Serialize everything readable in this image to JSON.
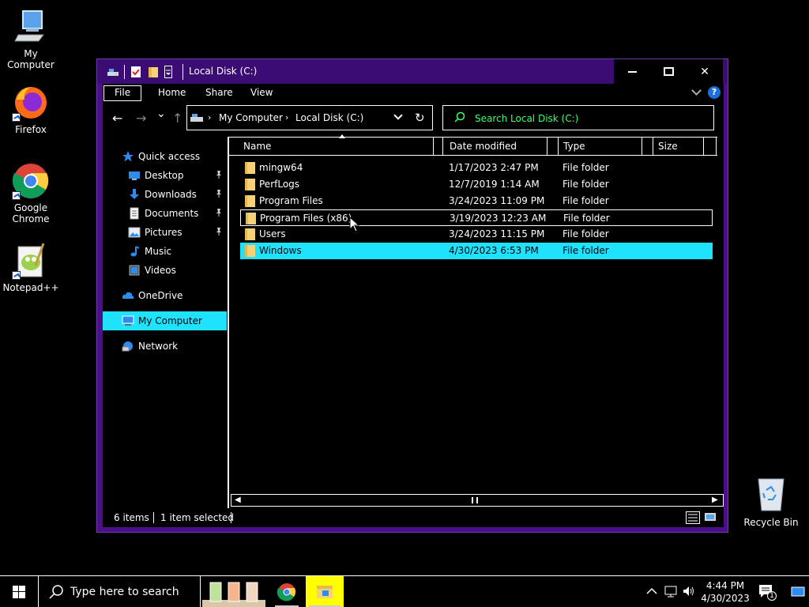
{
  "desktop": {
    "icons": [
      {
        "label": "My Computer"
      },
      {
        "label": "Firefox"
      },
      {
        "label": "Google Chrome"
      },
      {
        "label": "Notepad++"
      }
    ],
    "recycle_label": "Recycle Bin"
  },
  "window": {
    "title": "Local Disk (C:)",
    "close_glyph": "✕"
  },
  "ribbon": {
    "tabs": [
      "File",
      "Home",
      "Share",
      "View"
    ],
    "help_glyph": "?"
  },
  "nav": {
    "back": "←",
    "forward": "→",
    "recent": "⌄",
    "up": "↑",
    "breadcrumb": [
      "My Computer",
      "Local Disk (C:)"
    ],
    "crumb_sep": "›",
    "refresh": "↻",
    "search_placeholder": "Search Local Disk (C:)"
  },
  "navpane": {
    "items": [
      {
        "label": "Quick access",
        "icon": "star-icon"
      },
      {
        "label": "Desktop",
        "icon": "desktop-icon",
        "pinned": true
      },
      {
        "label": "Downloads",
        "icon": "download-icon",
        "pinned": true
      },
      {
        "label": "Documents",
        "icon": "document-icon",
        "pinned": true
      },
      {
        "label": "Pictures",
        "icon": "picture-icon",
        "pinned": true
      },
      {
        "label": "Music",
        "icon": "music-icon"
      },
      {
        "label": "Videos",
        "icon": "video-icon"
      },
      {
        "label": "OneDrive",
        "icon": "cloud-icon"
      },
      {
        "label": "My Computer",
        "icon": "computer-icon",
        "selected": true
      },
      {
        "label": "Network",
        "icon": "network-icon"
      }
    ]
  },
  "columns": {
    "name": "Name",
    "date": "Date modified",
    "type": "Type",
    "size": "Size"
  },
  "files": [
    {
      "name": "mingw64",
      "date": "1/17/2023 2:47 PM",
      "type": "File folder"
    },
    {
      "name": "PerfLogs",
      "date": "12/7/2019 1:14 AM",
      "type": "File folder"
    },
    {
      "name": "Program Files",
      "date": "3/24/2023 11:09 PM",
      "type": "File folder"
    },
    {
      "name": "Program Files (x86)",
      "date": "3/19/2023 12:23 AM",
      "type": "File folder"
    },
    {
      "name": "Users",
      "date": "3/24/2023 11:15 PM",
      "type": "File folder"
    },
    {
      "name": "Windows",
      "date": "4/30/2023 6:53 PM",
      "type": "File folder"
    }
  ],
  "status": {
    "items_count": "6 items",
    "selected_count": "1 item selected"
  },
  "taskbar": {
    "search_placeholder": "Type here to search",
    "time": "4:44 PM",
    "date": "4/30/2023",
    "notification_count": "1"
  },
  "colors": {
    "window_frame": "#4b0f8a",
    "selection": "#1fe2ff",
    "search_text": "#3fff6a"
  }
}
